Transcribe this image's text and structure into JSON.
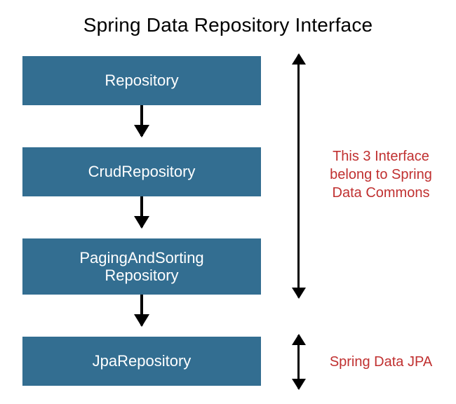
{
  "title": "Spring Data Repository Interface",
  "boxes": [
    {
      "label": "Repository"
    },
    {
      "label": "CrudRepository"
    },
    {
      "label": "PagingAndSorting\nRepository"
    },
    {
      "label": "JpaRepository"
    }
  ],
  "annotations": {
    "commons": "This 3 Interface belong to Spring Data Commons",
    "jpa": "Spring Data JPA"
  },
  "colors": {
    "box_fill": "#336e91",
    "box_text": "#ffffff",
    "annotation_text": "#c03030"
  }
}
